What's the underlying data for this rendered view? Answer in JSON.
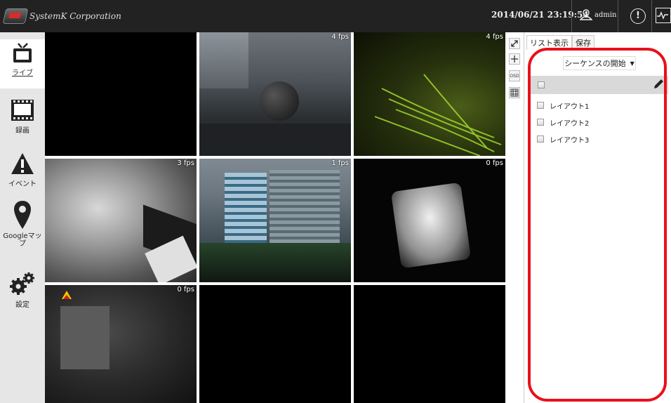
{
  "header": {
    "brand": "SystemK Corporation",
    "datetime": "2014/06/21 23:19:54",
    "user": "admin",
    "alert_glyph": "!"
  },
  "sidebar": {
    "items": [
      {
        "label": "ライブ",
        "icon": "tv-icon",
        "active": true
      },
      {
        "label": "録画",
        "icon": "film-icon",
        "active": false
      },
      {
        "label": "イベント",
        "icon": "warning-icon",
        "active": false
      },
      {
        "label": "Googleマップ",
        "icon": "map-pin-icon",
        "active": false
      },
      {
        "label": "設定",
        "icon": "gears-icon",
        "active": false
      }
    ]
  },
  "cameras": [
    {
      "fps": ""
    },
    {
      "fps": "4 fps"
    },
    {
      "fps": "4 fps"
    },
    {
      "fps": "3 fps"
    },
    {
      "fps": "1 fps"
    },
    {
      "fps": "0 fps"
    },
    {
      "fps": "0 fps"
    },
    {
      "fps": ""
    },
    {
      "fps": ""
    }
  ],
  "tools": {
    "expand_icon": "expand-icon",
    "add_icon": "plus-icon",
    "osd_label": "OSD",
    "grid_icon": "grid-layout-icon"
  },
  "panel": {
    "tabs": [
      "リスト表示",
      "保存"
    ],
    "sequence_label": "シーケンスの開始",
    "layouts": [
      "レイアウト1",
      "レイアウト2",
      "レイアウト3"
    ]
  },
  "colors": {
    "topbar": "#222222",
    "highlight_outline": "#e8101a"
  }
}
